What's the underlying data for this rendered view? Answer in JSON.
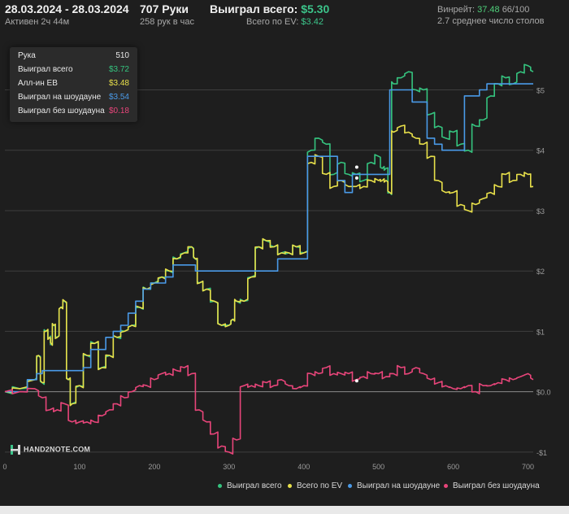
{
  "header": {
    "date_range": "28.03.2024 - 28.03.2024",
    "active": "Активен 2ч 44м",
    "hands": "707 Руки",
    "hands_rate": "258 рук в час",
    "won_label": "Выиграл всего:",
    "won_value": "$5.30",
    "ev_label": "Всего по EV:",
    "ev_value": "$3.42",
    "winrate_label": "Винрейт:",
    "winrate_value": "37.48",
    "winrate_hands": "66/100",
    "tables": "2.7 среднее число столов"
  },
  "tooltip": {
    "rows": [
      {
        "label": "Рука",
        "value": "510",
        "color": "#e8e8e8"
      },
      {
        "label": "Выиграл всего",
        "value": "$3.72",
        "color": "#35c47f"
      },
      {
        "label": "Алл-ин EB",
        "value": "$3.48",
        "color": "#e8e04a"
      },
      {
        "label": "Выиграл на шоудауне",
        "value": "$3.54",
        "color": "#4a9ae8"
      },
      {
        "label": "Выиграл без шоудауна",
        "value": "$0.18",
        "color": "#e8457a"
      }
    ]
  },
  "brand": "HAND2NOTE.COM",
  "chart_data": {
    "type": "line",
    "xlim": [
      0,
      707
    ],
    "ylim": [
      -1.15,
      5.95
    ],
    "x_ticks": [
      0,
      100,
      200,
      300,
      400,
      500,
      600,
      700
    ],
    "y_ticks": [
      -1,
      0,
      1,
      2,
      3,
      4,
      5
    ],
    "y_tick_labels": [
      "-$1",
      "$0.0",
      "$1",
      "$2",
      "$3",
      "$4",
      "$5"
    ],
    "grid": true,
    "legend_position": "bottom-right",
    "series": [
      {
        "name": "Выиграл всего",
        "color": "#35c47f",
        "x": [
          0,
          20,
          40,
          45,
          50,
          55,
          60,
          62,
          65,
          70,
          75,
          80,
          85,
          90,
          100,
          110,
          120,
          130,
          140,
          150,
          160,
          170,
          180,
          190,
          200,
          210,
          220,
          230,
          240,
          250,
          255,
          260,
          270,
          280,
          290,
          300,
          305,
          310,
          320,
          330,
          340,
          350,
          360,
          370,
          380,
          390,
          400,
          410,
          420,
          430,
          440,
          450,
          460,
          470,
          480,
          490,
          500,
          505,
          510,
          515,
          520,
          530,
          540,
          550,
          560,
          570,
          580,
          590,
          600,
          610,
          620,
          630,
          640,
          650,
          660,
          670,
          680,
          690,
          700,
          707
        ],
        "y": [
          0.0,
          0.05,
          0.2,
          0.6,
          0.15,
          1.0,
          0.9,
          0.8,
          1.1,
          0.9,
          1.4,
          1.5,
          0.2,
          -0.2,
          0.1,
          0.6,
          0.8,
          0.4,
          0.6,
          0.9,
          1.0,
          1.1,
          1.4,
          1.7,
          1.8,
          1.9,
          2.0,
          2.2,
          2.3,
          2.4,
          2.2,
          1.8,
          1.7,
          1.5,
          1.1,
          1.1,
          1.2,
          1.5,
          1.5,
          1.9,
          2.4,
          2.5,
          2.4,
          2.3,
          2.3,
          2.4,
          2.3,
          4.0,
          4.2,
          4.1,
          3.6,
          3.8,
          3.6,
          3.6,
          3.5,
          3.8,
          3.9,
          3.7,
          3.7,
          3.3,
          5.1,
          5.2,
          5.3,
          5.0,
          5.0,
          4.6,
          4.4,
          4.2,
          4.3,
          4.1,
          4.0,
          4.4,
          4.5,
          4.9,
          5.1,
          5.2,
          5.1,
          5.3,
          5.4,
          5.3
        ]
      },
      {
        "name": "Всего по EV",
        "color": "#e8e04a",
        "x": [
          0,
          20,
          40,
          45,
          50,
          55,
          60,
          62,
          65,
          70,
          75,
          80,
          85,
          90,
          100,
          110,
          120,
          130,
          140,
          150,
          160,
          170,
          180,
          190,
          200,
          210,
          220,
          230,
          240,
          250,
          255,
          260,
          270,
          280,
          290,
          300,
          305,
          310,
          320,
          330,
          340,
          350,
          360,
          370,
          380,
          390,
          400,
          410,
          420,
          430,
          440,
          450,
          460,
          470,
          480,
          490,
          500,
          505,
          510,
          515,
          520,
          530,
          540,
          550,
          560,
          570,
          580,
          590,
          600,
          610,
          620,
          630,
          640,
          650,
          660,
          670,
          680,
          690,
          700,
          707
        ],
        "y": [
          0.0,
          0.05,
          0.2,
          0.6,
          0.15,
          1.0,
          0.9,
          0.8,
          1.1,
          0.9,
          1.4,
          1.5,
          0.2,
          -0.2,
          0.1,
          0.6,
          0.8,
          0.4,
          0.6,
          0.9,
          1.0,
          1.1,
          1.4,
          1.7,
          1.8,
          1.9,
          2.0,
          2.2,
          2.3,
          2.4,
          2.2,
          1.8,
          1.7,
          1.5,
          1.1,
          1.1,
          1.2,
          1.5,
          1.5,
          1.9,
          2.4,
          2.5,
          2.4,
          2.3,
          2.3,
          2.4,
          2.3,
          3.8,
          3.9,
          3.6,
          3.4,
          3.5,
          3.4,
          3.4,
          3.4,
          3.5,
          3.5,
          3.5,
          3.5,
          3.3,
          4.3,
          4.4,
          4.3,
          4.2,
          4.1,
          3.9,
          3.5,
          3.3,
          3.3,
          3.1,
          3.0,
          3.1,
          3.2,
          3.3,
          3.4,
          3.6,
          3.5,
          3.6,
          3.6,
          3.4
        ]
      },
      {
        "name": "Выиграл на шоудауне",
        "color": "#4a9ae8",
        "x": [
          0,
          20,
          40,
          45,
          55,
          60,
          70,
          80,
          90,
          100,
          110,
          120,
          130,
          140,
          150,
          160,
          170,
          180,
          190,
          200,
          210,
          220,
          230,
          240,
          250,
          260,
          270,
          280,
          290,
          300,
          310,
          320,
          330,
          340,
          350,
          360,
          370,
          380,
          390,
          400,
          410,
          420,
          430,
          440,
          450,
          460,
          470,
          480,
          490,
          500,
          510,
          520,
          530,
          540,
          550,
          560,
          570,
          580,
          590,
          600,
          610,
          620,
          630,
          640,
          650,
          660,
          670,
          680,
          690,
          700,
          707
        ],
        "y": [
          0.0,
          0.0,
          0.2,
          0.3,
          0.35,
          0.35,
          0.35,
          0.35,
          0.35,
          0.35,
          0.4,
          0.7,
          0.7,
          0.9,
          1.0,
          1.1,
          1.3,
          1.5,
          1.7,
          1.8,
          1.8,
          1.9,
          2.1,
          2.1,
          2.1,
          2.0,
          2.0,
          2.0,
          2.0,
          2.0,
          2.0,
          2.0,
          2.0,
          2.0,
          2.0,
          2.0,
          2.2,
          2.2,
          2.2,
          2.2,
          3.9,
          3.9,
          3.9,
          3.9,
          3.5,
          3.3,
          3.6,
          3.6,
          3.6,
          3.6,
          3.6,
          5.0,
          5.0,
          5.0,
          4.8,
          4.8,
          4.2,
          4.1,
          4.0,
          4.0,
          4.0,
          4.9,
          4.9,
          5.0,
          5.1,
          5.1,
          5.1,
          5.1,
          5.1,
          5.1,
          5.1
        ]
      },
      {
        "name": "Выиграл без шоудауна",
        "color": "#e8457a",
        "x": [
          0,
          20,
          40,
          50,
          60,
          70,
          80,
          90,
          100,
          110,
          120,
          130,
          140,
          150,
          160,
          170,
          180,
          190,
          200,
          210,
          220,
          230,
          240,
          250,
          260,
          270,
          280,
          290,
          300,
          310,
          320,
          330,
          340,
          350,
          360,
          370,
          380,
          390,
          400,
          410,
          420,
          430,
          440,
          450,
          460,
          470,
          480,
          490,
          500,
          510,
          520,
          530,
          540,
          550,
          560,
          570,
          580,
          590,
          600,
          610,
          620,
          630,
          640,
          650,
          660,
          670,
          680,
          690,
          700,
          707
        ],
        "y": [
          0.0,
          0.0,
          0.05,
          -0.1,
          -0.3,
          -0.3,
          -0.2,
          -0.5,
          -0.5,
          -0.5,
          -0.5,
          -0.4,
          -0.3,
          -0.2,
          -0.1,
          0.0,
          0.1,
          0.1,
          0.2,
          0.3,
          0.3,
          0.35,
          0.4,
          0.3,
          -0.3,
          -0.5,
          -0.7,
          -0.9,
          -1.0,
          -0.8,
          0.1,
          0.1,
          0.1,
          0.15,
          0.1,
          0.2,
          0.1,
          0.05,
          0.1,
          0.3,
          0.3,
          0.4,
          0.3,
          0.3,
          0.3,
          0.2,
          0.25,
          0.3,
          0.3,
          0.25,
          0.3,
          0.4,
          0.3,
          0.4,
          0.3,
          0.2,
          0.15,
          0.1,
          0.05,
          0.05,
          0.1,
          0.0,
          0.1,
          0.1,
          0.15,
          0.2,
          0.2,
          0.25,
          0.3,
          0.2
        ]
      }
    ]
  }
}
